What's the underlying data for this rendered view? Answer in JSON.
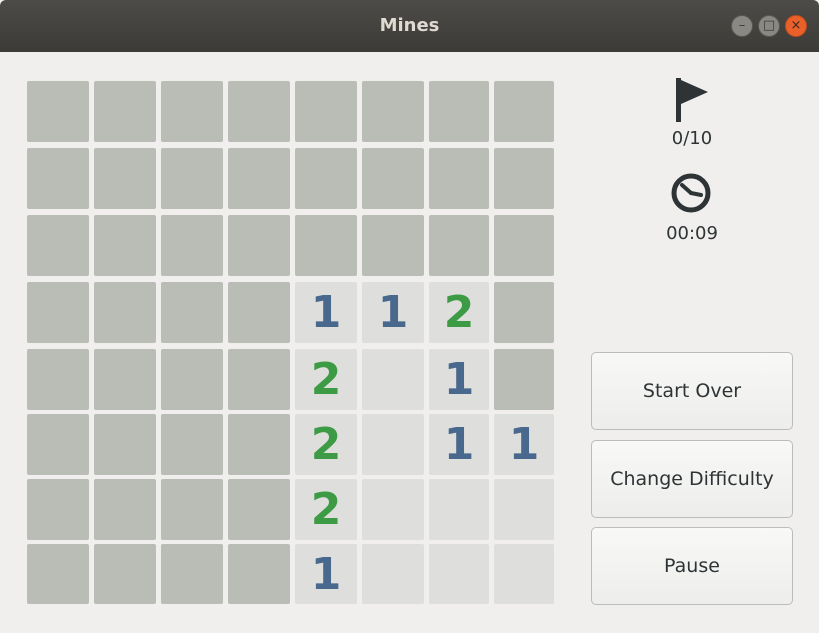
{
  "window": {
    "title": "Mines",
    "minimize_icon": "minimize-icon",
    "maximize_icon": "maximize-icon",
    "close_icon": "close-icon"
  },
  "board": {
    "rows": 8,
    "cols": 8,
    "cells": [
      [
        "c",
        "c",
        "c",
        "c",
        "c",
        "c",
        "c",
        "c"
      ],
      [
        "c",
        "c",
        "c",
        "c",
        "c",
        "c",
        "c",
        "c"
      ],
      [
        "c",
        "c",
        "c",
        "c",
        "c",
        "c",
        "c",
        "c"
      ],
      [
        "c",
        "c",
        "c",
        "c",
        "1",
        "1",
        "2",
        "c"
      ],
      [
        "c",
        "c",
        "c",
        "c",
        "2",
        "",
        "1",
        "c"
      ],
      [
        "c",
        "c",
        "c",
        "c",
        "2",
        "",
        "1",
        "1"
      ],
      [
        "c",
        "c",
        "c",
        "c",
        "2",
        "",
        "",
        ""
      ],
      [
        "c",
        "c",
        "c",
        "c",
        "1",
        "",
        "",
        ""
      ]
    ],
    "colors": {
      "covered": "#babdb6",
      "revealed": "#dededc",
      "one": "#48698d",
      "two": "#3d9b45"
    }
  },
  "status": {
    "flag_icon": "flag-icon",
    "flags": "0/10",
    "clock_icon": "clock-icon",
    "time": "00:09"
  },
  "buttons": {
    "start_over": "Start Over",
    "change_difficulty": "Change Difficulty",
    "pause": "Pause"
  }
}
